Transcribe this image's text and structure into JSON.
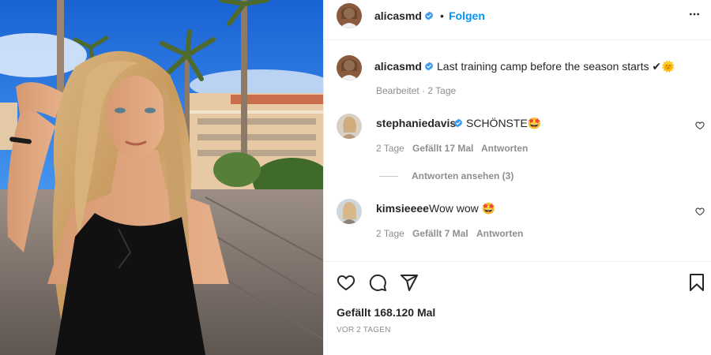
{
  "header": {
    "username": "alicasmd",
    "separator": "•",
    "follow_label": "Folgen"
  },
  "caption": {
    "username": "alicasmd",
    "text": "Last training camp before the season starts ✔🌞",
    "edited": "Bearbeitet",
    "dot": "·",
    "time": "2 Tage"
  },
  "comments": [
    {
      "username": "stephaniedavis",
      "text": "SCHÖNSTE🤩",
      "time": "2 Tage",
      "likes": "Gefällt 17 Mal",
      "reply_label": "Antworten",
      "view_replies": "Antworten ansehen (3)"
    },
    {
      "username": "kimsieeee",
      "text": "Wow wow 🤩",
      "time": "2 Tage",
      "likes": "Gefällt 7 Mal",
      "reply_label": "Antworten"
    }
  ],
  "footer": {
    "likes": "Gefällt 168.120 Mal",
    "date": "VOR 2 TAGEN"
  },
  "colors": {
    "accent": "#0095f6",
    "verified": "#3897f0",
    "muted": "#8e8e8e",
    "border": "#efefef"
  },
  "icons": [
    "verified-badge-icon",
    "more-options-icon",
    "heart-icon",
    "comment-icon",
    "share-icon",
    "bookmark-icon"
  ]
}
